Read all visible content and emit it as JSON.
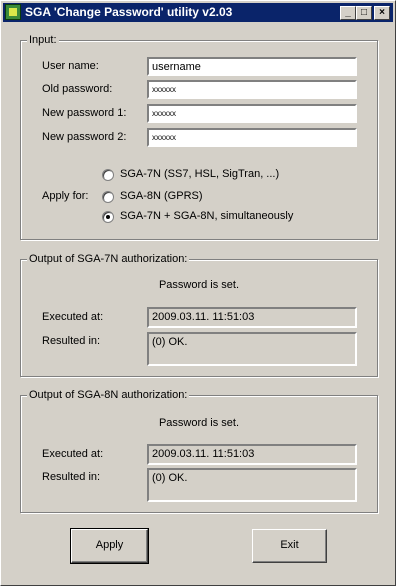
{
  "window": {
    "title": "SGA 'Change Password' utility  v2.03",
    "controls": {
      "minimize": "_",
      "maximize": "□",
      "close": "×"
    }
  },
  "input_group": {
    "label": "Input:",
    "user_name_label": "User name:",
    "user_name_value": "username",
    "old_password_label": "Old password:",
    "old_password_value": "xxxxxx",
    "new_password1_label": "New password 1:",
    "new_password1_value": "xxxxxx",
    "new_password2_label": "New password 2:",
    "new_password2_value": "xxxxxx",
    "apply_for_label": "Apply for:",
    "apply_options": [
      {
        "label": "SGA-7N  (SS7, HSL, SigTran, ...)",
        "checked": false
      },
      {
        "label": "SGA-8N  (GPRS)",
        "checked": false
      },
      {
        "label": "SGA-7N + SGA-8N, simultaneously",
        "checked": true
      }
    ]
  },
  "output_7n": {
    "label": "Output of SGA-7N authorization:",
    "status": "Password is set.",
    "executed_label": "Executed at:",
    "executed_value": "2009.03.11.  11:51:03",
    "resulted_label": "Resulted in:",
    "resulted_value": "(0)  OK."
  },
  "output_8n": {
    "label": "Output of SGA-8N authorization:",
    "status": "Password is set.",
    "executed_label": "Executed at:",
    "executed_value": "2009.03.11.  11:51:03",
    "resulted_label": "Resulted in:",
    "resulted_value": "(0)  OK."
  },
  "buttons": {
    "apply": "Apply",
    "exit": "Exit"
  }
}
